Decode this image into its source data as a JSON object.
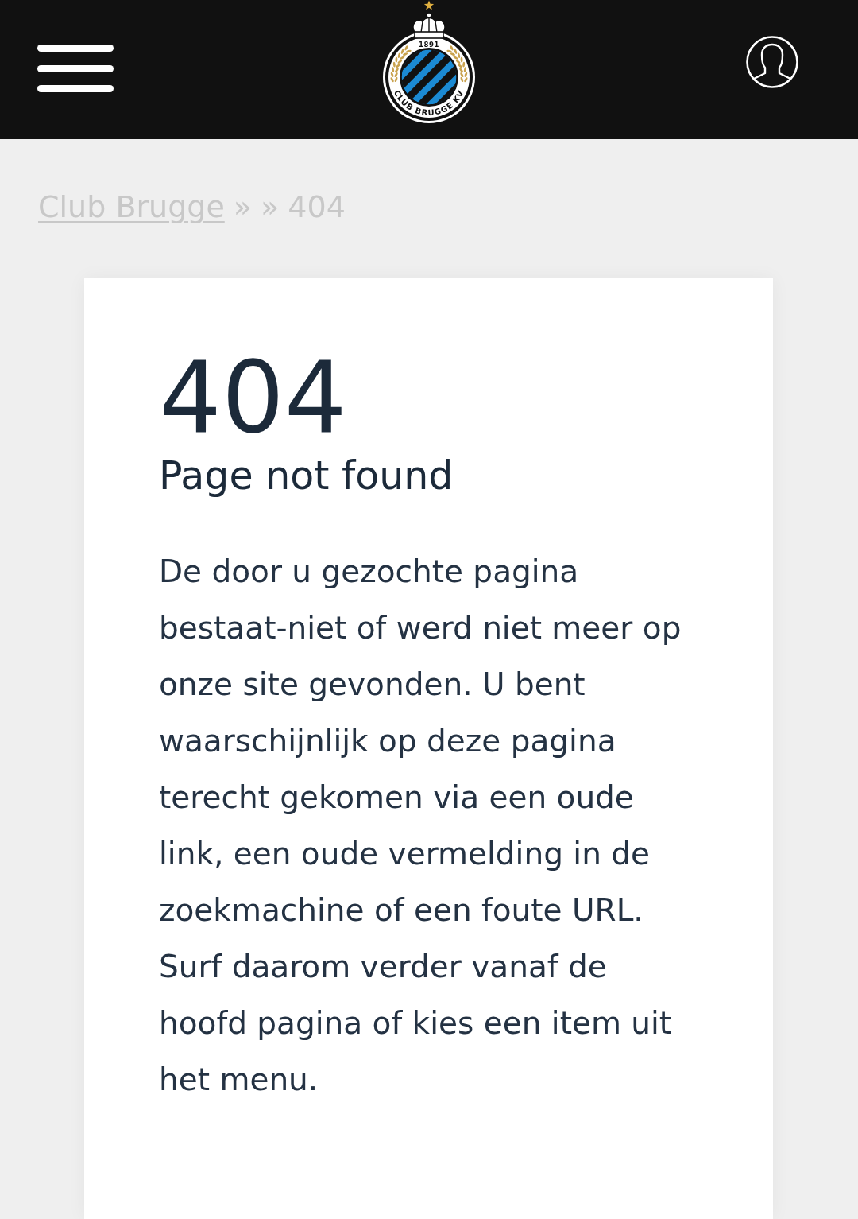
{
  "header": {
    "logo": {
      "year": "1891",
      "name": "CLUB BRUGGE KV"
    }
  },
  "breadcrumb": [
    {
      "kind": "link",
      "text": "Club Brugge"
    },
    {
      "kind": "separator",
      "text": "»"
    },
    {
      "kind": "separator",
      "text": "»"
    },
    {
      "kind": "current",
      "text": "404"
    }
  ],
  "card": {
    "code": "404",
    "title": "Page not found",
    "message": "De door u gezochte pagina bestaat-niet of werd niet meer op onze site gevonden. U bent waarschijnlijk op deze pagina terecht gekomen via een oude link, een oude vermelding in de zoekmachine of een foute URL. Surf daarom verder vanaf de hoofd pagina of kies een item uit het menu."
  }
}
